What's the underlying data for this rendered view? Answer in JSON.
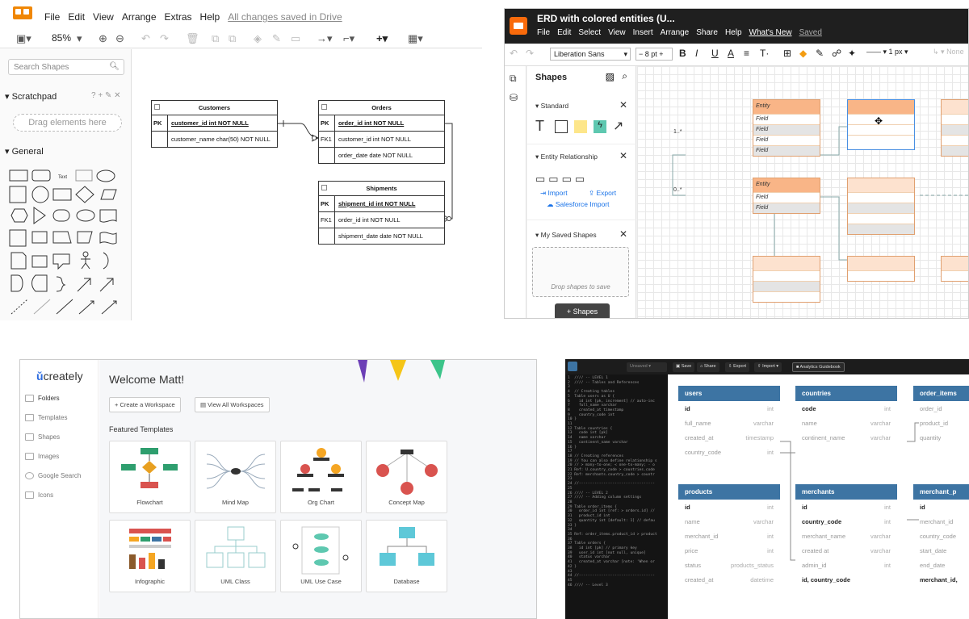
{
  "drawio": {
    "menu": [
      "File",
      "Edit",
      "View",
      "Arrange",
      "Extras",
      "Help"
    ],
    "saved_status": "All changes saved in Drive",
    "zoom": "85%",
    "search_placeholder": "Search Shapes",
    "scratchpad_label": "Scratchpad",
    "scratchpad_icons": "? + ✎ ✕",
    "drag_hint": "Drag elements here",
    "general_label": "General",
    "shape_text": "Text",
    "tables": [
      {
        "title": "Customers",
        "rows": [
          {
            "key": "PK",
            "value": "customer_id int NOT NULL",
            "pk": true
          },
          {
            "key": "",
            "value": "customer_name char(50) NOT NULL",
            "pk": false
          }
        ]
      },
      {
        "title": "Orders",
        "rows": [
          {
            "key": "PK",
            "value": "order_id int NOT NULL",
            "pk": true
          },
          {
            "key": "FK1",
            "value": "customer_id int NOT NULL",
            "pk": false
          },
          {
            "key": "",
            "value": "order_date date NOT NULL",
            "pk": false
          }
        ]
      },
      {
        "title": "Shipments",
        "rows": [
          {
            "key": "PK",
            "value": "shipment_id int NOT NULL",
            "pk": true
          },
          {
            "key": "FK1",
            "value": "order_id int NOT NULL",
            "pk": false
          },
          {
            "key": "",
            "value": "shipment_date date NOT NULL",
            "pk": false
          }
        ]
      }
    ]
  },
  "lucid": {
    "title": "ERD with colored entities (U...",
    "menu": [
      "File",
      "Edit",
      "Select",
      "View",
      "Insert",
      "Arrange",
      "Share",
      "Help"
    ],
    "whats_new": "What's New",
    "saved": "Saved",
    "font": "Liberation Sans",
    "font_size": "8 pt",
    "line_width": "1 px",
    "none_label": "None",
    "shapes_heading": "Shapes",
    "standard_label": "Standard",
    "er_label": "Entity Relationship",
    "import_label": "Import",
    "export_label": "Export",
    "salesforce_label": "Salesforce Import",
    "saved_shapes_label": "My Saved Shapes",
    "drop_hint": "Drop shapes to save",
    "add_shapes": "+ Shapes",
    "entity_label": "Entity",
    "field_label": "Field",
    "card_1": "1..*",
    "card_2": "0..*"
  },
  "creately": {
    "brand": "creately",
    "nav": [
      "Folders",
      "Templates",
      "Shapes",
      "Images",
      "Google Search",
      "Icons"
    ],
    "welcome": "Welcome Matt!",
    "create_workspace": "Create a Workspace",
    "view_workspaces": "View All Workspaces",
    "featured": "Featured Templates",
    "templates": [
      "Flowchart",
      "Mind Map",
      "Org Chart",
      "Concept Map",
      "Infographic",
      "UML Class",
      "UML Use Case",
      "Database"
    ]
  },
  "dbdiagram": {
    "toolbar": {
      "unsaved": "Unsaved",
      "save": "Save",
      "share": "Share",
      "export": "Export",
      "import": "Import",
      "guidebook": "Analytics Guidebook"
    },
    "code": "1  //// -- LEVEL 1\n2  //// -- Tables and References\n3\n4  // Creating tables\n5  Table users as U {\n6    id int [pk, increment] // auto-inc\n7    full_name varchar\n8    created_at timestamp\n9    country_code int\n10 }\n11\n12 Table countries {\n13   code int [pk]\n14   name varchar\n15   continent_name varchar\n16 }\n17\n18 // Creating references\n19 // You can also define relationship s\n20 // > many-to-one; < one-to-many; - o\n21 Ref: U.country_code > countries.code\n22 Ref: merchants.country_code > countr\n23\n24 //----------------------------------\n25\n26 //// -- LEVEL 2\n27 //// -- Adding column settings\n28\n29 Table order_items {\n30   order_id int [ref: > orders.id] //\n31   product_id int\n32   quantity int [default: 1] // defau\n33 }\n34\n35 Ref: order_items.product_id > product\n36\n37 Table orders {\n38   id int [pk] // primary key\n39   user_id int [not null, unique]\n40   status varchar\n41   created_at varchar [note: 'When or\n42 }\n43\n44 //----------------------------------\n45\n46 //// -- Level 3",
    "tables": [
      {
        "name": "users",
        "rows": [
          [
            "id",
            "int",
            true
          ],
          [
            "full_name",
            "varchar",
            false
          ],
          [
            "created_at",
            "timestamp",
            false
          ],
          [
            "country_code",
            "int",
            false
          ]
        ]
      },
      {
        "name": "countries",
        "rows": [
          [
            "code",
            "int",
            true
          ],
          [
            "name",
            "varchar",
            false
          ],
          [
            "continent_name",
            "varchar",
            false
          ]
        ]
      },
      {
        "name": "order_items",
        "rows": [
          [
            "order_id",
            "",
            false
          ],
          [
            "product_id",
            "",
            false
          ],
          [
            "quantity",
            "",
            false
          ]
        ]
      },
      {
        "name": "products",
        "rows": [
          [
            "id",
            "int",
            true
          ],
          [
            "name",
            "varchar",
            false
          ],
          [
            "merchant_id",
            "int",
            false
          ],
          [
            "price",
            "int",
            false
          ],
          [
            "status",
            "products_status",
            false
          ],
          [
            "created_at",
            "datetime",
            false
          ]
        ]
      },
      {
        "name": "merchants",
        "rows": [
          [
            "id",
            "int",
            true
          ],
          [
            "country_code",
            "int",
            true
          ],
          [
            "merchant_name",
            "varchar",
            false
          ],
          [
            "created at",
            "varchar",
            false
          ],
          [
            "admin_id",
            "int",
            false
          ],
          [
            "id, country_code",
            "",
            true
          ]
        ]
      },
      {
        "name": "merchant_p",
        "rows": [
          [
            "id",
            "",
            true
          ],
          [
            "merchant_id",
            "",
            false
          ],
          [
            "country_code",
            "",
            false
          ],
          [
            "start_date",
            "",
            false
          ],
          [
            "end_date",
            "",
            false
          ],
          [
            "merchant_id,",
            "",
            true
          ]
        ]
      }
    ]
  }
}
